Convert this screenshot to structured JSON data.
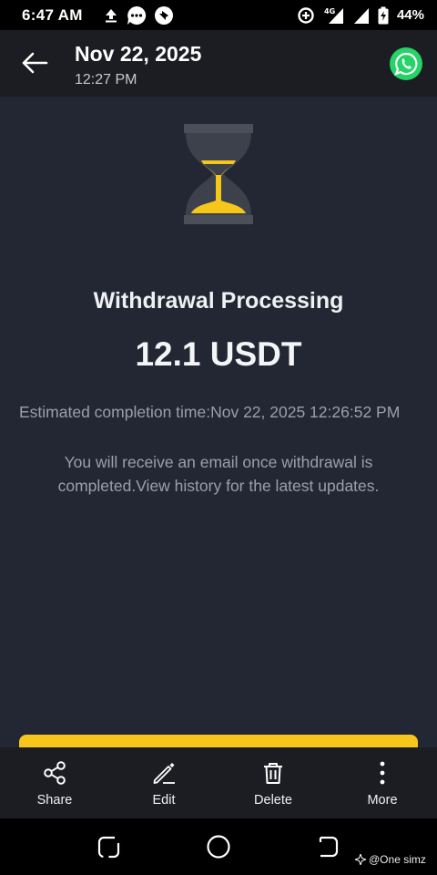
{
  "status_bar": {
    "time": "6:47 AM",
    "network": "4G",
    "battery": "44%",
    "left_icons": [
      "upload-icon",
      "chat-icon",
      "messenger-icon"
    ],
    "right_icons": [
      "data-saver-icon",
      "signal-4g-icon",
      "signal-icon",
      "battery-charging-icon"
    ]
  },
  "header": {
    "date": "Nov 22, 2025",
    "time": "12:27 PM",
    "back_icon": "arrow-left-icon",
    "share_icon": "whatsapp-icon"
  },
  "withdrawal": {
    "status_icon": "hourglass-icon",
    "title": "Withdrawal Processing",
    "amount": "12.1 USDT",
    "eta": "Estimated completion time:Nov 22, 2025 12:26:52 PM",
    "note": "You will receive an email once withdrawal is completed.View history for the latest updates."
  },
  "toolbar": {
    "share": "Share",
    "edit": "Edit",
    "delete": "Delete",
    "more": "More"
  },
  "watermark": "@One simz",
  "colors": {
    "accent": "#f7c61b",
    "background": "#222733",
    "header": "#1c1d22",
    "whatsapp": "#25d366"
  }
}
